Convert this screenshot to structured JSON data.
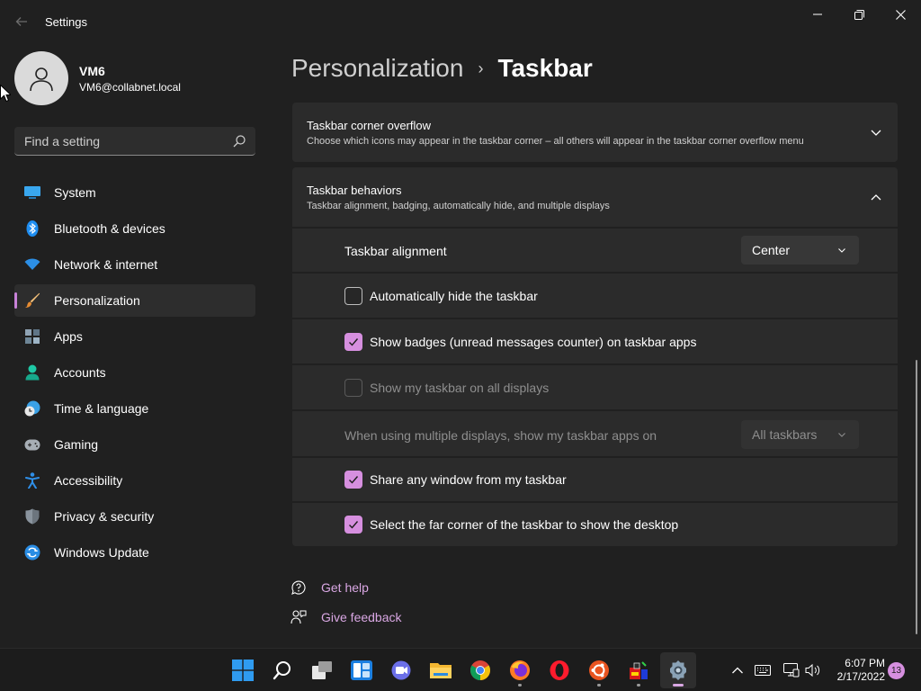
{
  "window": {
    "title": "Settings",
    "back_icon": "back-arrow-icon"
  },
  "profile": {
    "name": "VM6",
    "email": "VM6@collabnet.local"
  },
  "search": {
    "placeholder": "Find a setting"
  },
  "sidebar": {
    "items": [
      {
        "label": "System",
        "icon": "system-icon"
      },
      {
        "label": "Bluetooth & devices",
        "icon": "bluetooth-icon"
      },
      {
        "label": "Network & internet",
        "icon": "wifi-icon"
      },
      {
        "label": "Personalization",
        "icon": "brush-icon",
        "active": true
      },
      {
        "label": "Apps",
        "icon": "apps-icon"
      },
      {
        "label": "Accounts",
        "icon": "accounts-icon"
      },
      {
        "label": "Time & language",
        "icon": "clock-globe-icon"
      },
      {
        "label": "Gaming",
        "icon": "gamepad-icon"
      },
      {
        "label": "Accessibility",
        "icon": "accessibility-icon"
      },
      {
        "label": "Privacy & security",
        "icon": "shield-icon"
      },
      {
        "label": "Windows Update",
        "icon": "update-icon"
      }
    ]
  },
  "breadcrumb": {
    "parent": "Personalization",
    "separator": "›",
    "current": "Taskbar"
  },
  "sections": {
    "corner_overflow": {
      "title": "Taskbar corner overflow",
      "description": "Choose which icons may appear in the taskbar corner – all others will appear in the taskbar corner overflow menu",
      "expanded": false
    },
    "behaviors": {
      "title": "Taskbar behaviors",
      "description": "Taskbar alignment, badging, automatically hide, and multiple displays",
      "expanded": true
    }
  },
  "behaviors": {
    "alignment_label": "Taskbar alignment",
    "alignment_value": "Center",
    "auto_hide": {
      "label": "Automatically hide the taskbar",
      "checked": false
    },
    "badges": {
      "label": "Show badges (unread messages counter) on taskbar apps",
      "checked": true
    },
    "all_displays": {
      "label": "Show my taskbar on all displays",
      "checked": false,
      "disabled": true
    },
    "multi_display_label": "When using multiple displays, show my taskbar apps on",
    "multi_display_value": "All taskbars",
    "share_window": {
      "label": "Share any window from my taskbar",
      "checked": true
    },
    "far_corner": {
      "label": "Select the far corner of the taskbar to show the desktop",
      "checked": true
    }
  },
  "links": {
    "help": "Get help",
    "feedback": "Give feedback"
  },
  "taskbar": {
    "apps": [
      "windows-start-icon",
      "search-icon",
      "task-view-icon",
      "widgets-icon",
      "teams-chat-icon",
      "file-explorer-icon",
      "chrome-icon",
      "firefox-icon",
      "opera-icon",
      "ubuntu-icon",
      "app-icon",
      "settings-icon"
    ],
    "time": "6:07 PM",
    "date": "2/17/2022",
    "notification_count": "13"
  },
  "colors": {
    "accent": "#d68fdf",
    "background": "#202020",
    "card": "#2b2b2b"
  }
}
